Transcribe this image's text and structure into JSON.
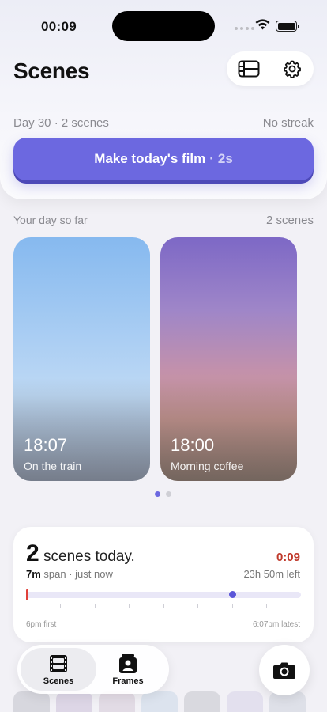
{
  "status_bar": {
    "time": "00:09"
  },
  "header": {
    "title": "Scenes",
    "day_label": "Day 30 · 2 scenes",
    "streak_label": "No streak",
    "make_button": {
      "label": "Make today's film",
      "separator": "·",
      "duration": "2s"
    },
    "icons": {
      "list": "film-list-icon",
      "settings": "gear-icon"
    }
  },
  "your_day": {
    "heading": "Your day so far",
    "count": "2 scenes",
    "scenes": [
      {
        "time": "18:07",
        "caption": "On the train"
      },
      {
        "time": "18:00",
        "caption": "Morning coffee"
      }
    ],
    "page_indicator": {
      "pages": 2,
      "active": 0
    }
  },
  "summary": {
    "count": "2",
    "label": "scenes today.",
    "timer": "0:09",
    "span_value": "7m",
    "span_text": "span · just now",
    "time_left": "23h 50m left",
    "first_label": "6pm first",
    "latest_label": "6:07pm latest",
    "latest_position": 0.75
  },
  "tabbar": {
    "tabs": [
      {
        "label": "Scenes",
        "icon": "film-strip-icon",
        "selected": true
      },
      {
        "label": "Frames",
        "icon": "portrait-frame-icon",
        "selected": false
      }
    ],
    "camera": {
      "icon": "camera-icon"
    }
  },
  "colors": {
    "accent": "#6c68e0",
    "timer_red": "#c0392b",
    "background": "#f2f1f6"
  }
}
